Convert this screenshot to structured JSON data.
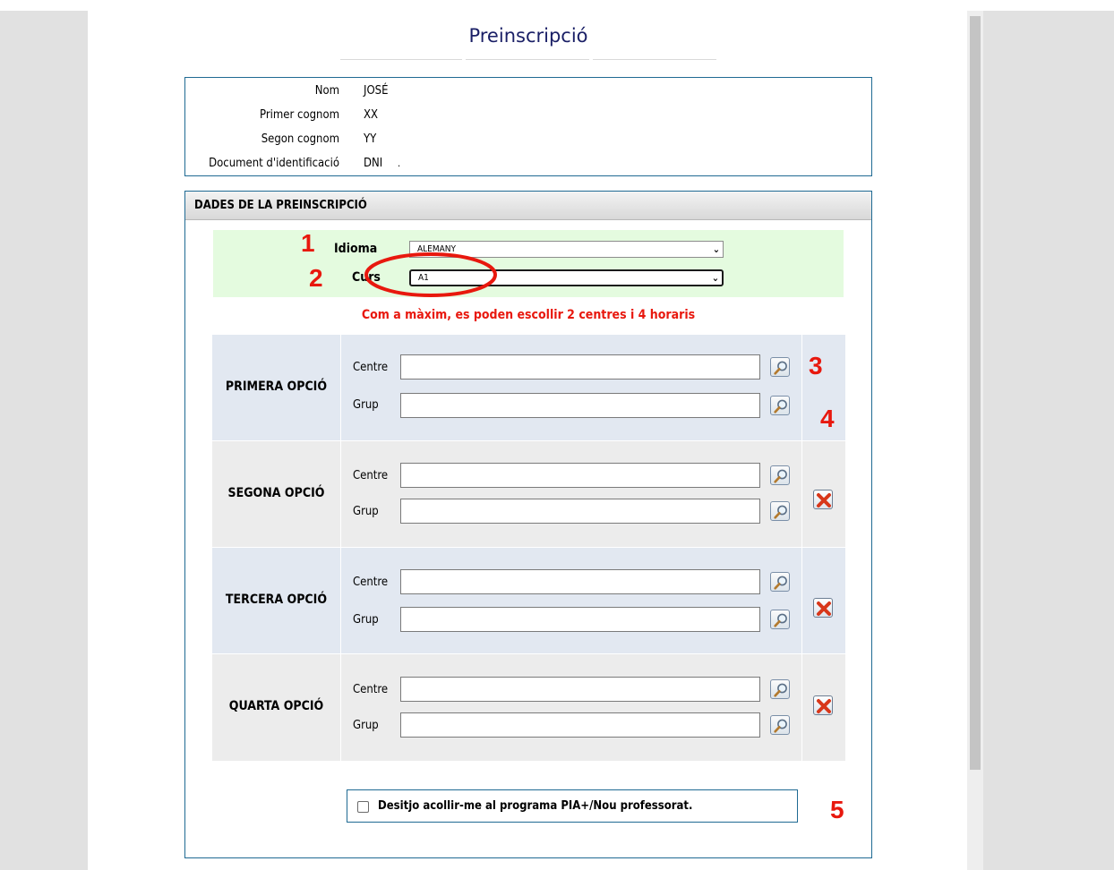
{
  "page": {
    "title": "Preinscripció"
  },
  "applicant": {
    "rows": [
      {
        "label": "Nom",
        "value": "JOSÉ"
      },
      {
        "label": "Primer cognom",
        "value": "XX"
      },
      {
        "label": "Segon cognom",
        "value": "YY"
      },
      {
        "label": "Document d'identificació",
        "value": "DNI"
      }
    ],
    "id_trailing": "."
  },
  "preinscription": {
    "header": "DADES DE LA PREINSCRIPCIÓ",
    "language_label": "Idioma",
    "language_value": "ALEMANY",
    "course_label": "Curs",
    "course_value": "A1",
    "warning": "Com a màxim, es poden escollir 2 centres i 4 horaris",
    "centre_label": "Centre",
    "group_label": "Grup",
    "options": [
      {
        "name": "PRIMERA OPCIÓ",
        "removable": false
      },
      {
        "name": "SEGONA OPCIÓ",
        "removable": true
      },
      {
        "name": "TERCERA OPCIÓ",
        "removable": true
      },
      {
        "name": "QUARTA OPCIÓ",
        "removable": true
      }
    ],
    "pia_label": "Desitjo acollir-me al programa PIA+/Nou professorat.",
    "pia_checked": false
  },
  "annotations": [
    "1",
    "2",
    "3",
    "4",
    "5"
  ],
  "colors": {
    "title": "#1a1f66",
    "border": "#1f6a93",
    "warning": "#e8180e",
    "green_zone": "#e4fbdf",
    "option_blue": "#e2e8f1",
    "option_gray": "#ececec"
  },
  "icons": {
    "search": "magnifier-icon",
    "delete": "red-x-icon",
    "dropdown": "chevron-down-icon"
  }
}
